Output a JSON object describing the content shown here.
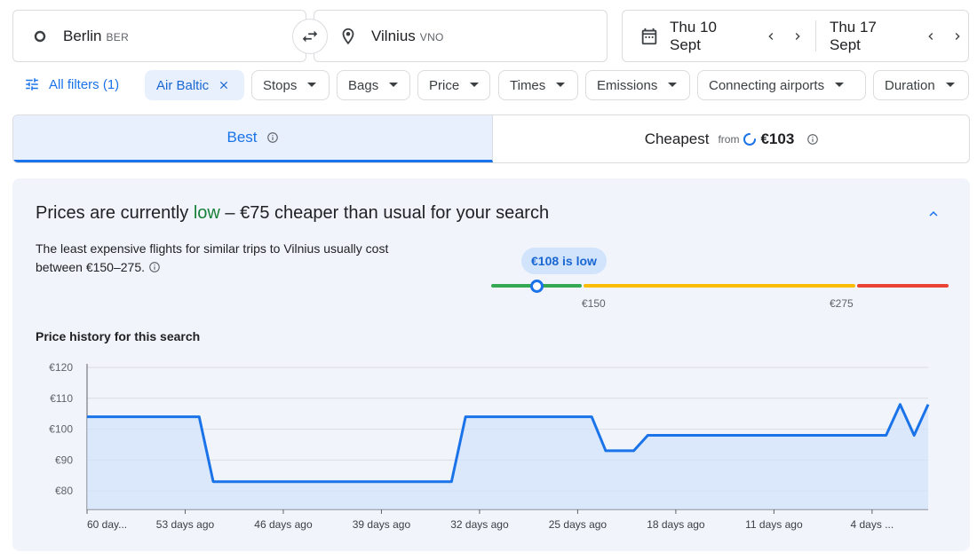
{
  "search": {
    "origin": {
      "city": "Berlin",
      "code": "BER"
    },
    "destination": {
      "city": "Vilnius",
      "code": "VNO"
    },
    "depart_date": "Thu 10 Sept",
    "return_date": "Thu 17 Sept"
  },
  "filters": {
    "all_filters_label": "All filters (1)",
    "selected_chip": "Air Baltic",
    "chips": [
      "Stops",
      "Bags",
      "Price",
      "Times",
      "Emissions",
      "Connecting airports",
      "Duration"
    ]
  },
  "tabs": {
    "best_label": "Best",
    "cheapest_label": "Cheapest",
    "cheapest_from": "from",
    "cheapest_price": "€103"
  },
  "insights": {
    "headline_prefix": "Prices are currently ",
    "headline_level": "low",
    "headline_suffix": " – €75 cheaper than usual for your search",
    "description": "The least expensive flights for similar trips to Vilnius usually cost between €150–275.",
    "gauge_bubble": "€108 is low",
    "gauge_low_label": "€150",
    "gauge_high_label": "€275",
    "gauge_level": 108,
    "price_history_title": "Price history for this search"
  },
  "colors": {
    "accent": "#1a73e8",
    "low": "#188038",
    "gauge_green": "#34a853",
    "gauge_yellow": "#fbbc04",
    "gauge_red": "#ea4335"
  },
  "chart_data": {
    "type": "line",
    "title": "Price history for this search",
    "xlabel": "",
    "ylabel": "",
    "ylim": [
      74,
      120
    ],
    "yticks": [
      80,
      90,
      100,
      110,
      120
    ],
    "ytick_labels": [
      "€80",
      "€90",
      "€100",
      "€110",
      "€120"
    ],
    "xlim": [
      -60,
      0
    ],
    "xtick_labels": [
      "60 day...",
      "53 days ago",
      "46 days ago",
      "39 days ago",
      "32 days ago",
      "25 days ago",
      "18 days ago",
      "11 days ago",
      "4 days ..."
    ],
    "xticks": [
      -60,
      -53,
      -46,
      -39,
      -32,
      -25,
      -18,
      -11,
      -4
    ],
    "grid": true,
    "series": [
      {
        "x": [
          -60,
          -52,
          -51,
          -34,
          -33,
          -24,
          -23,
          -21,
          -20,
          -19,
          -3,
          -2,
          -1,
          0
        ],
        "values": [
          104,
          104,
          83,
          83,
          104,
          104,
          93,
          93,
          98,
          98,
          98,
          108,
          98,
          108
        ]
      }
    ]
  }
}
